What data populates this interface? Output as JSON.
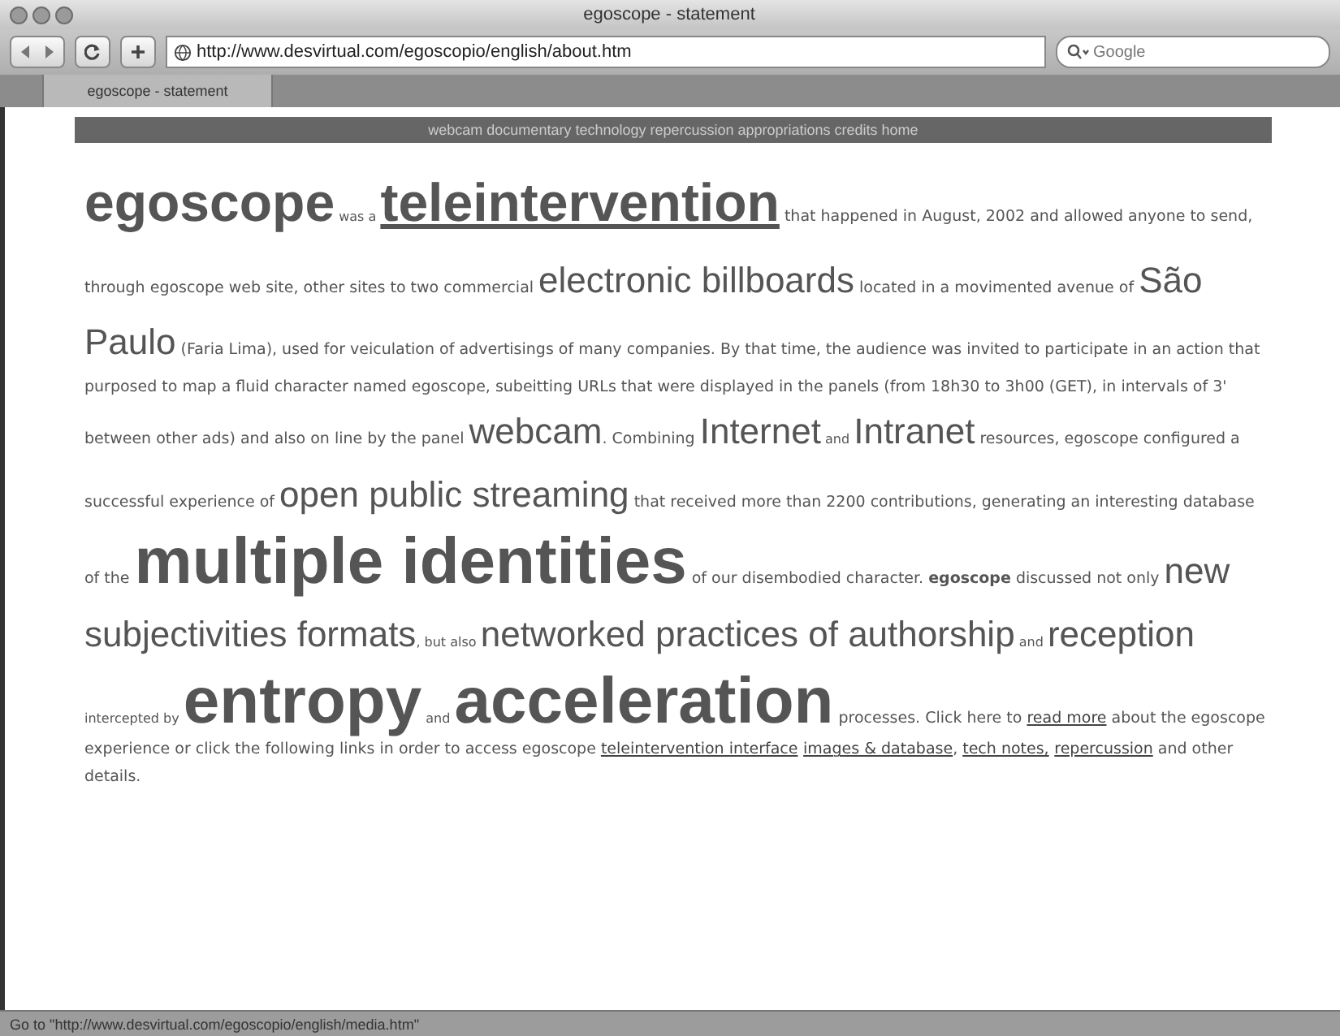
{
  "window": {
    "title": "egoscope - statement"
  },
  "toolbar": {
    "url": "http://www.desvirtual.com/egoscopio/english/about.htm",
    "search": {
      "placeholder": "Google"
    }
  },
  "tabs": [
    {
      "label": "egoscope - statement",
      "selected": true
    }
  ],
  "nav": {
    "text": "webcam documentary technology repercussion appropriations credits home"
  },
  "statement": [
    {
      "text": "egoscope",
      "kind": "headword"
    },
    {
      "text": " was a ",
      "kind": "aside"
    },
    {
      "text": "teleintervention",
      "kind": "headlink"
    },
    {
      "text": " that happened in August, 2002 and allowed anyone to send, through egoscope web site, other sites to two commercial ",
      "kind": "plain"
    },
    {
      "text": "electronic billboards",
      "kind": "term"
    },
    {
      "text": " located in a movimented avenue of ",
      "kind": "plain"
    },
    {
      "text": "São Paulo",
      "kind": "term"
    },
    {
      "text": " (Faria Lima), used for veiculation of advertisings of many companies. By that time, the audience was invited to participate in an action that purposed to map a fluid character named egoscope, subeitting URLs that were displayed in the panels (from 18h30 to 3h00 (GET), in intervals of 3' between other ads) and also on line by the panel ",
      "kind": "plain"
    },
    {
      "text": "webcam",
      "kind": "term"
    },
    {
      "text": ". Combining ",
      "kind": "plain"
    },
    {
      "text": "Internet",
      "kind": "term"
    },
    {
      "text": " and ",
      "kind": "aside"
    },
    {
      "text": "Intranet",
      "kind": "term"
    },
    {
      "text": " resources, egoscope configured a successful experience of ",
      "kind": "plain"
    },
    {
      "text": "open public streaming",
      "kind": "term"
    },
    {
      "text": " that received more than 2200 contributions, generating an interesting database of the ",
      "kind": "plain"
    },
    {
      "text": "multiple identities",
      "kind": "keyword"
    },
    {
      "text": " of our disembodied character. ",
      "kind": "plain"
    },
    {
      "text": "egoscope",
      "kind": "strong"
    },
    {
      "text": " discussed not only ",
      "kind": "plain"
    },
    {
      "text": "new subjectivities formats",
      "kind": "term"
    },
    {
      "text": ", but also ",
      "kind": "aside"
    },
    {
      "text": "networked practices of authorship",
      "kind": "term"
    },
    {
      "text": " and ",
      "kind": "aside"
    },
    {
      "text": "reception",
      "kind": "term"
    },
    {
      "text": " intercepted by ",
      "kind": "aside"
    },
    {
      "text": "entropy",
      "kind": "keyword"
    },
    {
      "text": " and ",
      "kind": "aside"
    },
    {
      "text": "acceleration",
      "kind": "keyword"
    },
    {
      "text": " processes. Click here to ",
      "kind": "plain"
    },
    {
      "text": "read more",
      "kind": "link"
    },
    {
      "text": " about the egoscope experience or click the following links in order to access egoscope ",
      "kind": "plain"
    },
    {
      "text": "teleintervention interface",
      "kind": "link"
    },
    {
      "text": "images & database",
      "kind": "link"
    },
    {
      "text": ", ",
      "kind": "plain"
    },
    {
      "text": "tech notes,",
      "kind": "link"
    },
    {
      "text": "repercussion",
      "kind": "link"
    },
    {
      "text": " and other details.",
      "kind": "plain"
    }
  ],
  "status_bar": {
    "text": "Go to \"http://www.desvirtual.com/egoscopio/english/media.htm\""
  }
}
